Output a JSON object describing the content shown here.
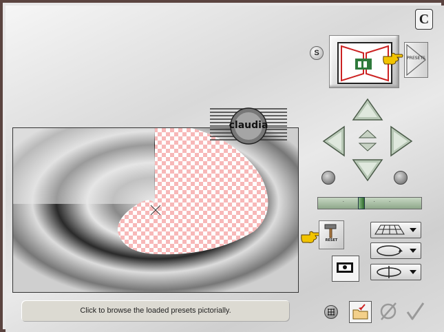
{
  "window": {
    "title": "",
    "border_color": "#5b4440"
  },
  "top_right": {
    "c_icon_label": "C"
  },
  "buttons": {
    "s_label": "S",
    "presets_label": "PRESETS",
    "reset_label": "RESET"
  },
  "icons": {
    "pointer": "pointing-hand-icon",
    "nav_up": "arrow-up-icon",
    "nav_down": "arrow-down-icon",
    "nav_left": "arrow-left-icon",
    "nav_right": "arrow-right-icon",
    "rotate_left": "rotate-left-icon",
    "rotate_right": "rotate-right-icon",
    "grid": "grid-icon",
    "folder": "folder-import-icon",
    "cancel": "cancel-icon",
    "ok": "checkmark-icon",
    "mask": "mask-icon",
    "hammer": "hammer-icon"
  },
  "slider": {
    "ticks": "· · · ·"
  },
  "preview": {
    "watermark_text": "claudia",
    "checker_color": "#f7b8b8"
  },
  "status": {
    "text": "Click to browse the loaded presets pictorially."
  },
  "colors": {
    "accent_yellow": "#f2c400",
    "slider_green": "#7fa57a"
  }
}
